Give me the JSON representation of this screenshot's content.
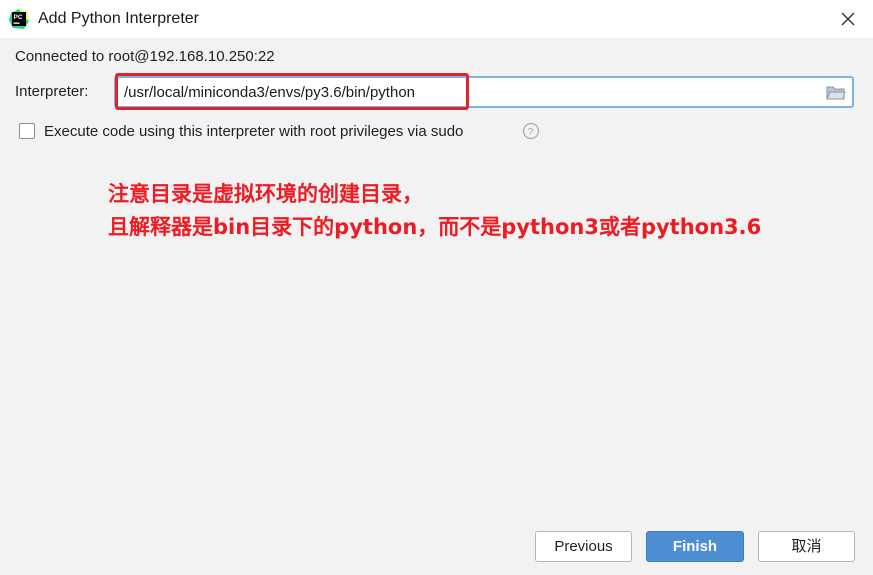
{
  "window": {
    "title": "Add Python Interpreter",
    "icon": "pycharm-icon"
  },
  "connection": {
    "text": "Connected to root@192.168.10.250:22"
  },
  "interpreter": {
    "label": "Interpreter:",
    "value": "/usr/local/miniconda3/envs/py3.6/bin/python"
  },
  "sudo": {
    "label": "Execute code using this interpreter with root privileges via sudo",
    "checked": false
  },
  "annotation": {
    "line1": "注意目录是虚拟环境的创建目录，",
    "line2": "且解释器是bin目录下的python，而不是python3或者python3.6",
    "color": "#ed1c24"
  },
  "buttons": {
    "previous": "Previous",
    "finish": "Finish",
    "cancel": "取消"
  },
  "colors": {
    "accent": "#4e8fd3",
    "highlight": "#e0242b"
  }
}
